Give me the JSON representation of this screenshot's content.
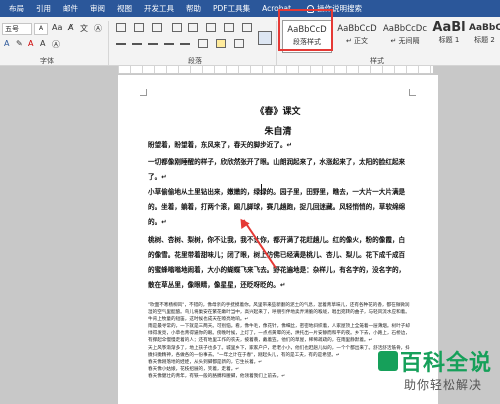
{
  "ribbon_tabs": [
    "布局",
    "引用",
    "邮件",
    "审阅",
    "视图",
    "开发工具",
    "帮助",
    "PDF工具集",
    "Acrobat"
  ],
  "tell_me": "操作说明搜索",
  "font": {
    "name": "五号",
    "size": "A",
    "group_label": "字体"
  },
  "paragraph_group_label": "段落",
  "styles_group_label": "样式",
  "styles": [
    {
      "sample": "AaBbCcD",
      "name": "段落样式"
    },
    {
      "sample": "AaBbCcD",
      "name": "↵ 正文"
    },
    {
      "sample": "AaBbCcDc",
      "name": "↵ 无间隔"
    },
    {
      "sample": "AaBl",
      "name": "标题 1"
    },
    {
      "sample": "AaBbC",
      "name": "标题 2"
    }
  ],
  "doc": {
    "title": "《春》课文",
    "author": "朱自清",
    "paragraphs": [
      "盼望着，盼望着，东风来了，春天的脚步近了。↵",
      "一切都像刚睡醒的样子，欣欣然张开了眼。山朗润起来了，水涨起来了，太阳的脸红起来了。↵",
      "小草偷偷地从土里钻出来，嫩嫩的，绿绿的。园子里，田野里，瞧去，一大片一大片满是的。坐着，躺着，打两个滚，踢几脚球，赛几趟跑，捉几回迷藏。风轻悄悄的，草软绵绵的。↵",
      "桃树、杏树、梨树，你不让我，我不让你，都开满了花赶趟儿。红的像火，粉的像霞，白的像雪。花里带着甜味儿；闭了眼，树上仿佛已经满是桃儿、杏儿、梨儿。花下成千成百的蜜蜂嗡嗡地闹着，大小的蝴蝶飞来飞去。野花遍地是：杂样儿，有名字的，没名字的，散在草丛里，像眼睛，像星星，还眨呀眨的。↵"
    ],
    "small_lines": [
      "\"吹面不寒杨柳风\"，不错的，像母亲的手抚摸着你。风里带来些新翻的泥土的气息，混着青草味儿，还有各种花的香，都在微微润湿的空气里酝酿。鸟儿将巢安在繁花嫩叶当中，高兴起来了，呼朋引伴地卖弄清脆的喉咙，唱出宛转的曲子，与轻风流水应和着。牛背上牧童的短笛，这时候也成天在嘹亮地响。↵",
      "雨是最寻常的，一下就是三两天。可别恼。看，像牛毛，像花针，像细丝，密密地斜织着，人家屋顶上全笼着一层薄烟。树叶子却绿得发亮，小草也青得逼你的眼。傍晚时候，上灯了，一点点黄晕的光，烘托出一片安静而和平的夜。乡下去，小路上，石桥边，有撑起伞慢慢走着的人；还有地里工作的农夫，披着蓑，戴着笠。他们的草屋，稀稀疏疏的，在雨里静默着。↵",
      "天上风筝渐渐多了，地上孩子也多了。城里乡下，家家户户，老老小小，他们也赶趟儿似的，一个个都出来了。舒活舒活筋骨，抖擞抖擞精神，各做各的一份事去。\"一年之计在于春\"，刚起头儿，有的是工夫，有的是希望。↵",
      "春天像刚落地的娃娃，从头到脚都是新的，它生长着。↵",
      "春天像小姑娘，花枝招展的，笑着，走着。↵",
      "春天像健壮的青年，有铁一般的胳膊和腰脚，他领着我们上前去。↵"
    ]
  },
  "watermark": {
    "main": "百科全说",
    "sub": "助你轻松解决"
  },
  "colors": {
    "ribbon_blue": "#2b579a",
    "highlight_red": "#e53935",
    "watermark_green": "#16a05a"
  }
}
